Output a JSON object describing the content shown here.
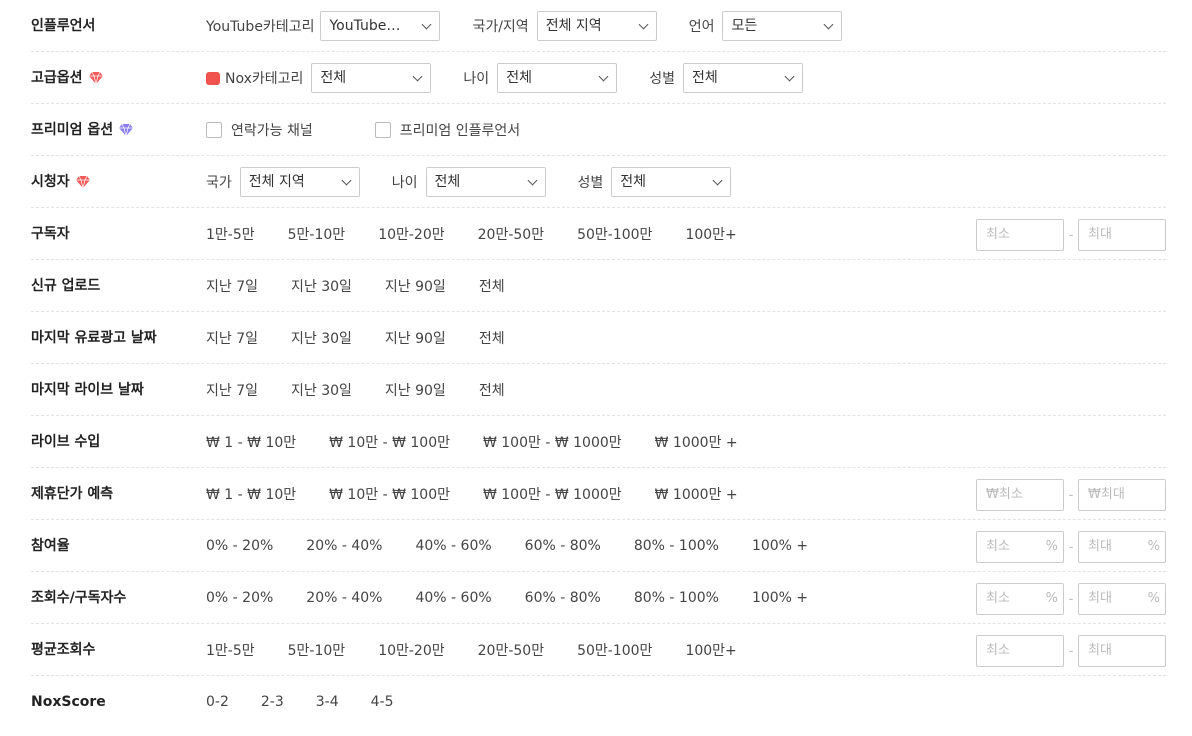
{
  "rows": {
    "influencer": {
      "label": "인플루언서",
      "yt_category_label": "YouTube카테고리",
      "yt_category_value": "YouTube…",
      "country_label": "국가/지역",
      "country_value": "전체 지역",
      "language_label": "언어",
      "language_value": "모든"
    },
    "advanced": {
      "label": "고급옵션",
      "nox_category_label": "Nox카테고리",
      "nox_category_value": "전체",
      "age_label": "나이",
      "age_value": "전체",
      "gender_label": "성별",
      "gender_value": "전체"
    },
    "premium": {
      "label": "프리미엄 옵션",
      "contact_label": "연락가능 채널",
      "premium_label": "프리미엄 인플루언서"
    },
    "audience": {
      "label": "시청자",
      "country_label": "국가",
      "country_value": "전체 지역",
      "age_label": "나이",
      "age_value": "전체",
      "gender_label": "성별",
      "gender_value": "전체"
    },
    "subscribers": {
      "label": "구독자",
      "options": [
        "1만-5만",
        "5만-10만",
        "10만-20만",
        "20만-50만",
        "50만-100만",
        "100만+"
      ],
      "min_placeholder": "최소",
      "max_placeholder": "최대"
    },
    "new_upload": {
      "label": "신규 업로드",
      "options": [
        "지난 7일",
        "지난 30일",
        "지난 90일",
        "전체"
      ]
    },
    "last_ad": {
      "label": "마지막 유료광고 날짜",
      "options": [
        "지난 7일",
        "지난 30일",
        "지난 90일",
        "전체"
      ]
    },
    "last_live": {
      "label": "마지막 라이브 날짜",
      "options": [
        "지난 7일",
        "지난 30일",
        "지난 90일",
        "전체"
      ]
    },
    "live_income": {
      "label": "라이브 수입",
      "options": [
        "₩ 1 - ₩ 10만",
        "₩ 10만 - ₩ 100만",
        "₩ 100만 - ₩ 1000만",
        "₩ 1000만 +"
      ]
    },
    "affiliate": {
      "label": "제휴단가 예측",
      "options": [
        "₩ 1 - ₩ 10만",
        "₩ 10만 - ₩ 100만",
        "₩ 100만 - ₩ 1000만",
        "₩ 1000만 +"
      ],
      "min_placeholder": "₩최소",
      "max_placeholder": "₩최대"
    },
    "engagement": {
      "label": "참여율",
      "options": [
        "0% - 20%",
        "20% - 40%",
        "40% - 60%",
        "60% - 80%",
        "80% - 100%",
        "100% +"
      ],
      "min_placeholder": "최소",
      "max_placeholder": "최대",
      "unit": "%"
    },
    "views_subs": {
      "label": "조회수/구독자수",
      "options": [
        "0% - 20%",
        "20% - 40%",
        "40% - 60%",
        "60% - 80%",
        "80% - 100%",
        "100% +"
      ],
      "min_placeholder": "최소",
      "max_placeholder": "최대",
      "unit": "%"
    },
    "avg_views": {
      "label": "평균조회수",
      "options": [
        "1만-5만",
        "5만-10만",
        "10만-20만",
        "20만-50만",
        "50만-100만",
        "100만+"
      ],
      "min_placeholder": "최소",
      "max_placeholder": "최대"
    },
    "noxscore": {
      "label": "NoxScore",
      "options": [
        "0-2",
        "2-3",
        "3-4",
        "4-5"
      ]
    }
  },
  "icons": {
    "premium_gem": "diamond-icon",
    "nox_logo": "nox-logo-icon"
  },
  "colors": {
    "gem_red": "#f05a5a",
    "gem_purple": "#8a7df0",
    "nox_red": "#f0524e"
  }
}
